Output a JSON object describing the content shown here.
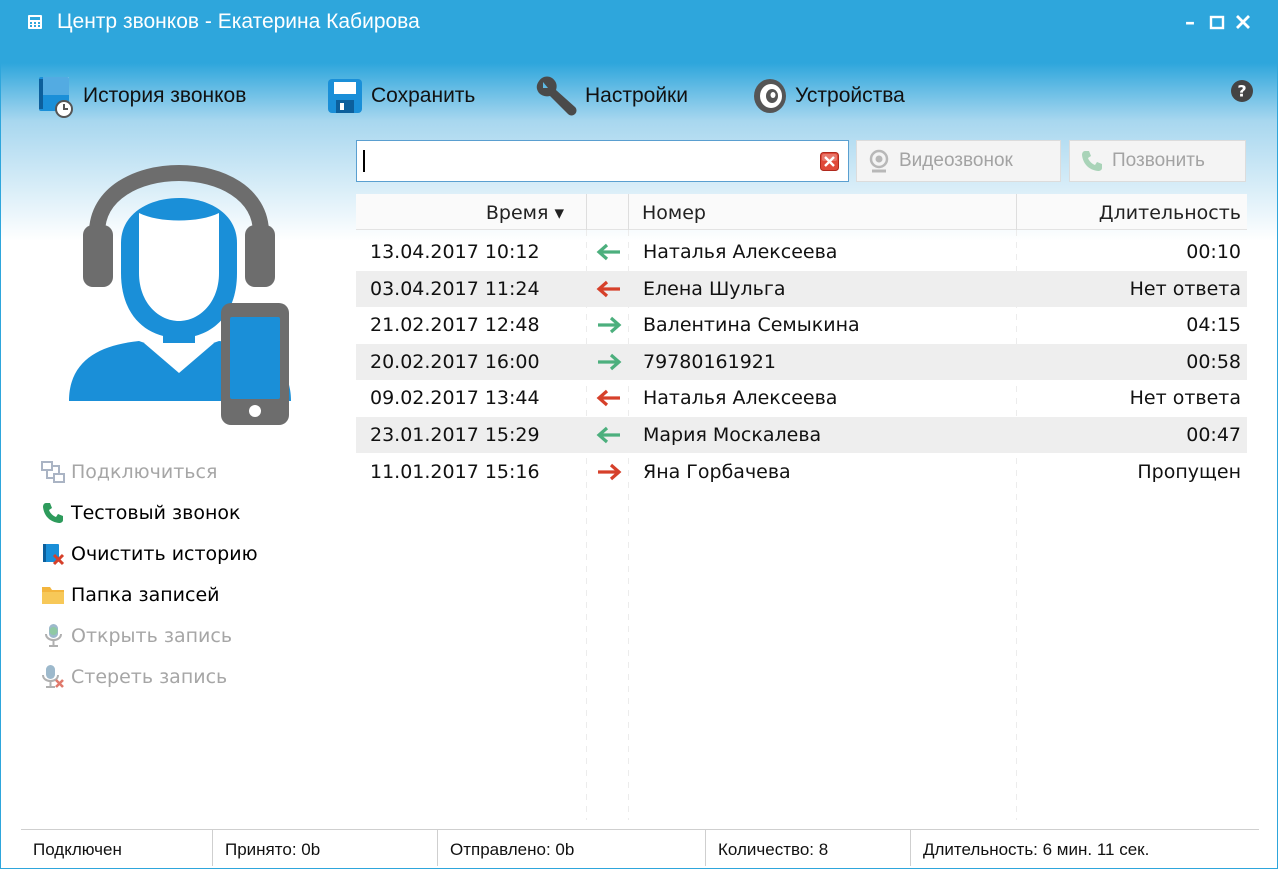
{
  "window": {
    "title": "Центр звонков - Екатерина Кабирова",
    "minimize_label": "–",
    "maximize_label": "☐",
    "close_label": "✕"
  },
  "toolbar": {
    "history_label": "История звонков",
    "save_label": "Сохранить",
    "settings_label": "Настройки",
    "devices_label": "Устройства"
  },
  "side_menu": [
    {
      "label": "Подключиться",
      "enabled": false,
      "icon": "connect-icon"
    },
    {
      "label": "Тестовый звонок",
      "enabled": true,
      "icon": "phone-icon"
    },
    {
      "label": "Очистить историю",
      "enabled": true,
      "icon": "clear-history-icon"
    },
    {
      "label": "Папка записей",
      "enabled": true,
      "icon": "folder-icon"
    },
    {
      "label": "Открыть запись",
      "enabled": false,
      "icon": "microphone-icon"
    },
    {
      "label": "Стереть запись",
      "enabled": false,
      "icon": "microphone-delete-icon"
    }
  ],
  "search": {
    "value": "",
    "placeholder": ""
  },
  "buttons": {
    "video_call_label": "Видеозвонок",
    "call_label": "Позвонить"
  },
  "table": {
    "headers": {
      "time": "Время ▾",
      "direction": "",
      "number": "Номер",
      "duration": "Длительность"
    },
    "rows": [
      {
        "time": "13.04.2017 10:12",
        "direction": "incoming",
        "arrow_color": "#4caf7d",
        "number": "Наталья Алексеева",
        "duration": "00:10"
      },
      {
        "time": "03.04.2017 11:24",
        "direction": "incoming-missed",
        "arrow_color": "#d6402a",
        "number": "Елена Шульга",
        "duration": "Нет ответа"
      },
      {
        "time": "21.02.2017 12:48",
        "direction": "outgoing",
        "arrow_color": "#4caf7d",
        "number": "Валентина Семыкина",
        "duration": "04:15"
      },
      {
        "time": "20.02.2017 16:00",
        "direction": "outgoing",
        "arrow_color": "#4caf7d",
        "number": "79780161921",
        "duration": "00:58"
      },
      {
        "time": "09.02.2017 13:44",
        "direction": "incoming-missed",
        "arrow_color": "#d6402a",
        "number": "Наталья Алексеева",
        "duration": "Нет ответа"
      },
      {
        "time": "23.01.2017 15:29",
        "direction": "incoming",
        "arrow_color": "#4caf7d",
        "number": "Мария Москалева",
        "duration": "00:47"
      },
      {
        "time": "11.01.2017 15:16",
        "direction": "outgoing-missed",
        "arrow_color": "#d6402a",
        "number": "Яна Горбачева",
        "duration": "Пропущен"
      }
    ]
  },
  "status": {
    "connection": "Подключен",
    "received": "Принято: 0b",
    "sent": "Отправлено: 0b",
    "count": "Количество: 8",
    "duration": "Длительность: 6 мин. 11 сек."
  },
  "colors": {
    "accent": "#2ea6dc",
    "incoming_arrow": "#4caf7d",
    "missed_arrow": "#d6402a",
    "avatar_blue": "#1a8fd8",
    "avatar_gray": "#6d6d6d"
  }
}
